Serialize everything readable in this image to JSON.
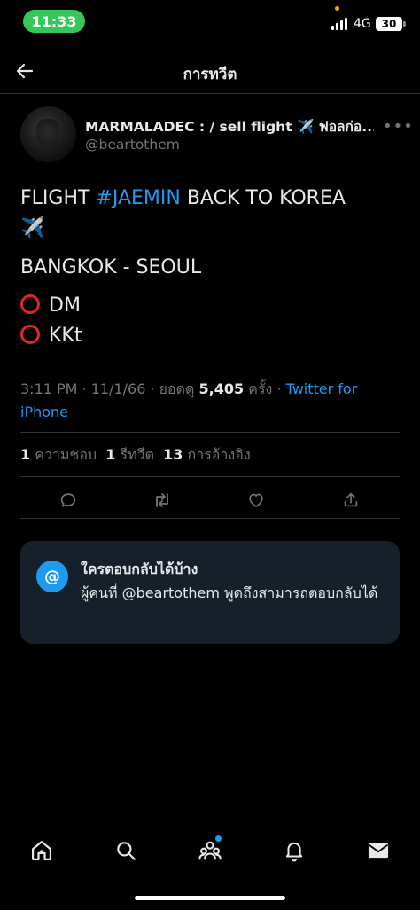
{
  "status_bar": {
    "time": "11:33",
    "network": "4G",
    "battery": "30"
  },
  "header": {
    "title": "การทวีต"
  },
  "tweet": {
    "display_name": "MARMALADEC : / sell flight ✈️ ฟอลก่อ...",
    "handle": "@beartothem",
    "line1_prefix": "FLIGHT ",
    "hashtag": "#JAEMIN",
    "line1_suffix": " BACK TO KOREA",
    "line2_emoji": "✈️",
    "route": "BANGKOK - SEOUL",
    "contact1": "DM",
    "contact2": "KKt",
    "meta_time": "3:11 PM · 11/1/66 · ยอดดู ",
    "views": "5,405",
    "views_suffix": " ครั้ง · ",
    "source": "Twitter for iPhone"
  },
  "stats": {
    "likes_count": "1",
    "likes_label": "ความชอบ",
    "retweets_count": "1",
    "retweets_label": "รีทวีต",
    "quotes_count": "13",
    "quotes_label": "การอ้างอิง"
  },
  "reply_card": {
    "badge": "@",
    "title": "ใครตอบกลับได้บ้าง",
    "description": "ผู้คนที่ @beartothem พูดถึงสามารถตอบกลับได้"
  },
  "colors": {
    "accent": "#1d9bf0",
    "background": "#000000",
    "card": "#15202b",
    "muted": "#71767b",
    "status_green": "#34c759"
  }
}
